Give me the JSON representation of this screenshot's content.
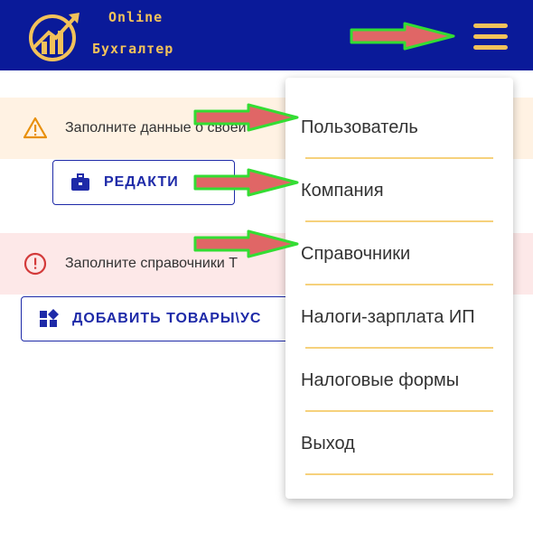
{
  "header": {
    "brand_line1": "Online",
    "brand_line2": "Бухгалтер",
    "colors": {
      "background": "#0a1a99",
      "accent": "#f2c25a"
    },
    "logo_icon": "rising-chart-logo",
    "menu_icon": "hamburger-icon"
  },
  "alerts": [
    {
      "type": "warning",
      "icon": "warning-triangle-icon",
      "text": "Заполните данные о своей"
    },
    {
      "type": "error",
      "icon": "error-circle-icon",
      "text": "Заполните справочники Т"
    }
  ],
  "buttons": {
    "edit": {
      "label": "РЕДАКТИ",
      "icon": "briefcase-icon"
    },
    "add": {
      "label": "ДОБАВИТЬ ТОВАРЫ\\УС",
      "icon": "widgets-icon"
    }
  },
  "menu": {
    "items": [
      {
        "label": "Пользователь"
      },
      {
        "label": "Компания"
      },
      {
        "label": "Справочники"
      },
      {
        "label": "Налоги-зарплата ИП"
      },
      {
        "label": "Налоговые формы"
      },
      {
        "label": "Выход"
      }
    ],
    "divider_color": "#f6d17c"
  },
  "annotations": {
    "arrow_color": "#e06666",
    "arrow_outline": "#33dd33"
  }
}
